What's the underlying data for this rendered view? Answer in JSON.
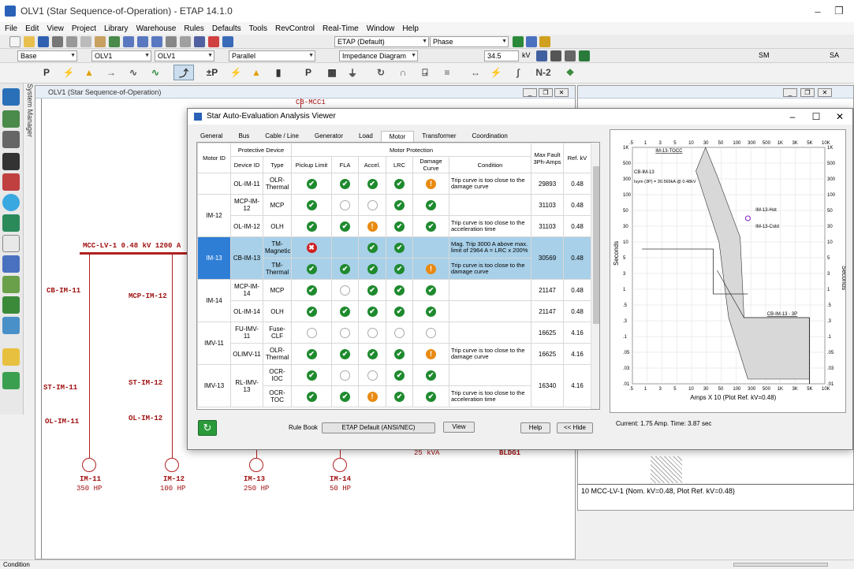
{
  "window": {
    "title": "OLV1 (Star Sequence-of-Operation) - ETAP 14.1.0"
  },
  "menu": [
    "File",
    "Edit",
    "View",
    "Project",
    "Library",
    "Warehouse",
    "Rules",
    "Defaults",
    "Tools",
    "RevControl",
    "Real-Time",
    "Window",
    "Help"
  ],
  "toolbar": {
    "preset": "ETAP (Default)",
    "phase": "Phase",
    "base": "Base",
    "olv": "OLV1",
    "olv2": "OLV1",
    "parallel": "Parallel",
    "study": "Impedance Diagram",
    "kv_value": "34.5",
    "kv_unit": "kV",
    "sm": "SM",
    "sa": "SA",
    "n2": "N-2"
  },
  "left_panel": {
    "label": "System Manager"
  },
  "olv_window": {
    "title": "OLV1 (Star Sequence-of-Operation)"
  },
  "oneline": {
    "bus_label": "MCC-LV-1  0.48 kV  1200 A",
    "top_label": "CB-MCC1",
    "cb1": "CB-IM-11",
    "cb2": "MCP-IM-12",
    "st1": "ST-IM-11",
    "st2": "ST-IM-12",
    "ol1": "OL-IM-11",
    "ol2": "OL-IM-12",
    "motors": [
      {
        "id": "IM-11",
        "hp": "350 HP"
      },
      {
        "id": "IM-12",
        "hp": "100 HP"
      },
      {
        "id": "IM-13",
        "hp": "250 HP"
      },
      {
        "id": "IM-14",
        "hp": "50 HP"
      }
    ],
    "kva": "25 kVA",
    "bldg": "BLDG1"
  },
  "tcc2": {
    "footer": "10   MCC-LV-1 (Nom. kV=0.48, Plot Ref. kV=0.48)"
  },
  "dialog": {
    "title": "Star Auto-Evaluation Analysis Viewer",
    "tabs": [
      "General",
      "Bus",
      "Cable / Line",
      "Generator",
      "Load",
      "Motor",
      "Transformer",
      "Coordination"
    ],
    "headers": {
      "motor_id": "Motor ID",
      "protective": "Protective Device",
      "device_id": "Device ID",
      "type": "Type",
      "motor_protection": "Motor Protection",
      "pickup": "Pickup Limit",
      "fla": "FLA",
      "accel": "Accel.",
      "lrc": "LRC",
      "damage": "Damage Curve",
      "condition": "Condition",
      "maxfault": "Max Fault 3Ph-Amps",
      "refkv": "Ref. kV"
    },
    "rows": [
      {
        "motor": "",
        "dev": "OL-IM-11",
        "type": "OLR-Thermal",
        "p": "ok",
        "f": "ok",
        "a": "ok",
        "l": "ok",
        "d": "warn",
        "cond": "Trip curve is too close to the damage curve",
        "fault": "29893",
        "kv": "0.48",
        "mspan": 1,
        "sel": false
      },
      {
        "motor": "IM-12",
        "dev": "MCP-IM-12",
        "type": "MCP",
        "p": "ok",
        "f": "none",
        "a": "none",
        "l": "ok",
        "d": "ok",
        "cond": "",
        "fault": "31103",
        "kv": "0.48",
        "mspan": 2,
        "sel": false
      },
      {
        "motor": null,
        "dev": "OL-IM-12",
        "type": "OLH",
        "p": "ok",
        "f": "ok",
        "a": "warn",
        "l": "ok",
        "d": "ok",
        "cond": "Trip curve is too close to the acceleration time",
        "fault": "31103",
        "kv": "0.48",
        "sel": false
      },
      {
        "motor": "IM-13",
        "dev": "CB-IM-13",
        "type": "TM-Magnetic",
        "p": "err",
        "f": "",
        "a": "ok",
        "l": "ok",
        "d": "",
        "cond": "Mag. Trip 3000 A above max. limit of 2964 A = LRC x 200%",
        "fault": "30569",
        "kv": "0.48",
        "mspan": 2,
        "dspan": 2,
        "sel": true
      },
      {
        "motor": null,
        "dev": null,
        "type": "TM-Thermal",
        "p": "ok",
        "f": "ok",
        "a": "ok",
        "l": "ok",
        "d": "warn",
        "cond": "Trip curve is too close to the damage curve",
        "fault": null,
        "kv": null,
        "sel": true
      },
      {
        "motor": "IM-14",
        "dev": "MCP-IM-14",
        "type": "MCP",
        "p": "ok",
        "f": "none",
        "a": "ok",
        "l": "ok",
        "d": "ok",
        "cond": "",
        "fault": "21147",
        "kv": "0.48",
        "mspan": 2,
        "sel": false
      },
      {
        "motor": null,
        "dev": "OL-IM-14",
        "type": "OLH",
        "p": "ok",
        "f": "ok",
        "a": "ok",
        "l": "ok",
        "d": "ok",
        "cond": "",
        "fault": "21147",
        "kv": "0.48",
        "sel": false
      },
      {
        "motor": "IMV-11",
        "dev": "FU-IMV-11",
        "type": "Fuse-CLF",
        "p": "none",
        "f": "none",
        "a": "none",
        "l": "none",
        "d": "none",
        "cond": "",
        "fault": "16625",
        "kv": "4.16",
        "mspan": 2,
        "sel": false
      },
      {
        "motor": null,
        "dev": "OLIMV-11",
        "type": "OLR-Thermal",
        "p": "ok",
        "f": "ok",
        "a": "ok",
        "l": "ok",
        "d": "warn",
        "cond": "Trip curve is too close to the damage curve",
        "fault": "16625",
        "kv": "4.16",
        "sel": false
      },
      {
        "motor": "IMV-13",
        "dev": "RL-IMV-13",
        "type": "OCR-IOC",
        "p": "ok",
        "f": "none",
        "a": "none",
        "l": "ok",
        "d": "ok",
        "cond": "",
        "fault": "16340",
        "kv": "4.16",
        "mspan": 2,
        "dspan": 2,
        "sel": false
      },
      {
        "motor": null,
        "dev": null,
        "type": "OCR-TOC",
        "p": "ok",
        "f": "ok",
        "a": "warn",
        "l": "ok",
        "d": "ok",
        "cond": "Trip curve is too close to the acceleration time",
        "fault": null,
        "kv": null,
        "sel": false
      }
    ],
    "rulebook_label": "Rule Book",
    "rulebook_value": "ETAP Default (ANSI/NEC)",
    "view_btn": "View",
    "help_btn": "Help",
    "hide_btn": "<< Hide",
    "plot": {
      "xlabel": "Amps  X  10 (Plot Ref. kV=0.48)",
      "ylabel": "Seconds",
      "xticks": [
        ".5",
        "1",
        "3",
        "5",
        "10",
        "30",
        "50",
        "100",
        "300",
        "500",
        "1K",
        "3K",
        "5K",
        "10K"
      ],
      "yticks": [
        "1K",
        "500",
        "300",
        "100",
        "50",
        "30",
        "10",
        "5",
        "3",
        "1",
        ".5",
        ".3",
        ".1",
        ".05",
        ".03",
        ".01"
      ],
      "labels": {
        "top": "IM-13-TOCC",
        "cb": "CB-IM-13",
        "isc": "Isym (3P) = 30.569kA @ 0.48kV",
        "hot": "IM-13-Hot",
        "cold": "IM-13-Cold",
        "cb3p": "CB-IM-13 - 3P"
      },
      "status": "Current: 1.75 Amp.  Time: 3.87 sec"
    }
  },
  "statusbar": {
    "text": "Condition"
  }
}
